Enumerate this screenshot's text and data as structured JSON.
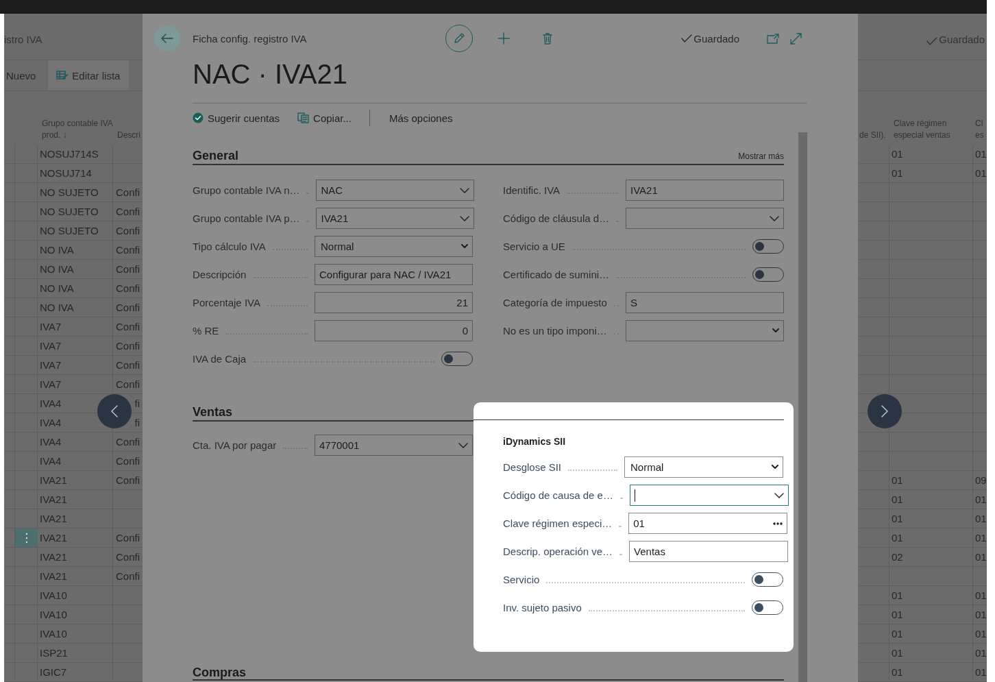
{
  "background_list": {
    "title": "istro IVA",
    "status": "Guardado",
    "actions": [
      {
        "label": "Nuevo"
      },
      {
        "label": "Editar lista"
      }
    ],
    "columns": [
      "Grupo contable IVA prod. ↓",
      "Descri",
      "de SII).",
      "Clave régimen especial ventas",
      "Cl es"
    ],
    "rows": [
      {
        "grupo": "NOSUJ714S",
        "clave": "01",
        "column_5": "01",
        "selected": false
      },
      {
        "grupo": "NOSUJ714",
        "clave": "01",
        "column_5": "01",
        "selected": false
      },
      {
        "grupo": "NO SUJETO",
        "descripcion": "Confi",
        "selected": false
      },
      {
        "grupo": "NO SUJETO",
        "descripcion": "Confi",
        "selected": false
      },
      {
        "grupo": "NO SUJETO",
        "descripcion": "Confi",
        "selected": false
      },
      {
        "grupo": "NO IVA",
        "descripcion": "Confi",
        "selected": false
      },
      {
        "grupo": "NO IVA",
        "descripcion": "Confi",
        "selected": false
      },
      {
        "grupo": "NO IVA",
        "descripcion": "Confi",
        "selected": false
      },
      {
        "grupo": "NO IVA",
        "descripcion": "Confi",
        "selected": false
      },
      {
        "grupo": "IVA7",
        "descripcion": "Confi",
        "selected": false
      },
      {
        "grupo": "IVA7",
        "descripcion": "Confi",
        "selected": false
      },
      {
        "grupo": "IVA7",
        "descripcion": "Confi",
        "selected": false
      },
      {
        "grupo": "IVA7",
        "descripcion": "Confi",
        "selected": false
      },
      {
        "grupo": "IVA4",
        "descripcion": "fi",
        "selected": false
      },
      {
        "grupo": "IVA4",
        "descripcion": "fi",
        "selected": false
      },
      {
        "grupo": "IVA4",
        "descripcion": "Confi",
        "selected": false
      },
      {
        "grupo": "IVA4",
        "descripcion": "Confi",
        "selected": false
      },
      {
        "grupo": "IVA21",
        "descripcion": "Confi",
        "clave": "01",
        "column_5": "09",
        "selected": false
      },
      {
        "grupo": "IVA21",
        "clave": "01",
        "column_5": "01",
        "selected": false
      },
      {
        "grupo": "IVA21",
        "clave": "01",
        "column_5": "01",
        "selected": false
      },
      {
        "grupo": "IVA21",
        "descripcion": "Confi",
        "clave": "01",
        "column_5": "01",
        "selected": true
      },
      {
        "grupo": "IVA21",
        "descripcion": "Confi",
        "clave": "02",
        "column_5": "01",
        "selected": false
      },
      {
        "grupo": "IVA21",
        "descripcion": "Confi",
        "selected": false
      },
      {
        "grupo": "IVA10",
        "clave": "01",
        "column_5": "01",
        "selected": false
      },
      {
        "grupo": "IVA10",
        "clave": "01",
        "column_5": "01",
        "selected": false
      },
      {
        "grupo": "IVA10",
        "clave": "01",
        "column_5": "01",
        "selected": false
      },
      {
        "grupo": "ISP21",
        "clave": "01",
        "column_5": "01",
        "selected": false
      },
      {
        "grupo": "IGIC7",
        "clave": "01",
        "column_5": "01",
        "selected": false
      }
    ]
  },
  "card": {
    "breadcrumb": "Ficha config. registro IVA",
    "status": "Guardado",
    "title": "NAC · IVA21",
    "actions": [
      {
        "label": "Sugerir cuentas"
      },
      {
        "label": "Copiar..."
      },
      {
        "label": "Más opciones"
      }
    ],
    "sections": [
      {
        "title": "General",
        "more": "Mostrar más",
        "left": [
          {
            "label": "Grupo contable IVA n…",
            "kind": "lookup",
            "value": "NAC"
          },
          {
            "label": "Grupo contable IVA p…",
            "kind": "lookup",
            "value": "IVA21"
          },
          {
            "label": "Tipo cálculo IVA",
            "kind": "dropdown",
            "value": "Normal"
          },
          {
            "label": "Descripción",
            "kind": "text",
            "value": "Configurar para NAC / IVA21"
          },
          {
            "label": "Porcentaje IVA",
            "kind": "number",
            "value": "21"
          },
          {
            "label": "% RE",
            "kind": "number",
            "value": "0"
          },
          {
            "label": "IVA de Caja",
            "kind": "toggle",
            "on": false
          }
        ],
        "right": [
          {
            "label": "Identific. IVA",
            "kind": "text",
            "value": "IVA21"
          },
          {
            "label": "Código de cláusula d…",
            "kind": "lookup"
          },
          {
            "label": "Servicio a UE",
            "kind": "toggle",
            "on": false
          },
          {
            "label": "Certificado de sumini…",
            "kind": "toggle",
            "on": false
          },
          {
            "label": "Categoría de impuesto",
            "kind": "text",
            "value": "S"
          },
          {
            "label": "No es un tipo imponi…",
            "kind": "dropdown"
          }
        ]
      },
      {
        "title": "Ventas",
        "left": [
          {
            "label": "Cta. IVA por pagar",
            "kind": "lookup",
            "value": "4770001"
          }
        ],
        "popup": {
          "title": "iDynamics SII",
          "fields": [
            {
              "label": "Desglose SII",
              "kind": "dropdown",
              "value": "Normal",
              "focused": false
            },
            {
              "label": "Código de causa de e…",
              "kind": "lookup",
              "focused": true
            },
            {
              "label": "Clave régimen especi…",
              "kind": "assist",
              "value": "01",
              "focused": false
            },
            {
              "label": "Descrip. operación ve…",
              "kind": "text",
              "value": "Ventas",
              "focused": false
            },
            {
              "label": "Servicio",
              "kind": "toggle",
              "on": false
            },
            {
              "label": "Inv. sujeto pasivo",
              "kind": "toggle",
              "on": false
            }
          ]
        }
      },
      {
        "title": "Compras"
      }
    ]
  }
}
